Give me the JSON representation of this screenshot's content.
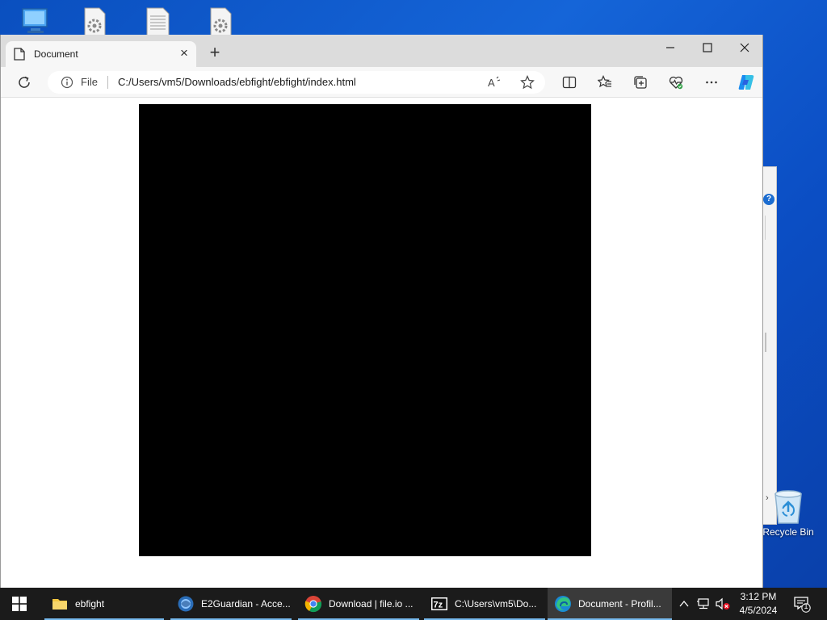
{
  "desktop": {
    "icons": [
      "computer-icon",
      "settings-file-icon",
      "text-file-icon",
      "settings-file-icon"
    ],
    "recycle_bin_label": "Recycle Bin"
  },
  "browser": {
    "tab": {
      "title": "Document"
    },
    "address_bar": {
      "scheme_label": "File",
      "url": "C:/Users/vm5/Downloads/ebfight/ebfight/index.html"
    },
    "canvas_color": "#000000"
  },
  "taskbar": {
    "items": [
      {
        "label": "ebfight",
        "icon": "folder-icon"
      },
      {
        "label": "E2Guardian - Acce...",
        "icon": "e2guardian-icon"
      },
      {
        "label": "Download | file.io ...",
        "icon": "chrome-icon"
      },
      {
        "label": "C:\\Users\\vm5\\Do...",
        "icon": "7zip-icon"
      },
      {
        "label": "Document - Profil...",
        "icon": "edge-icon"
      }
    ],
    "clock": {
      "time": "3:12 PM",
      "date": "4/5/2024"
    },
    "notification_count": "1"
  },
  "colors": {
    "accent": "#76b9ed",
    "taskbar": "#1b1b1b",
    "desktop": "#1565d8"
  }
}
